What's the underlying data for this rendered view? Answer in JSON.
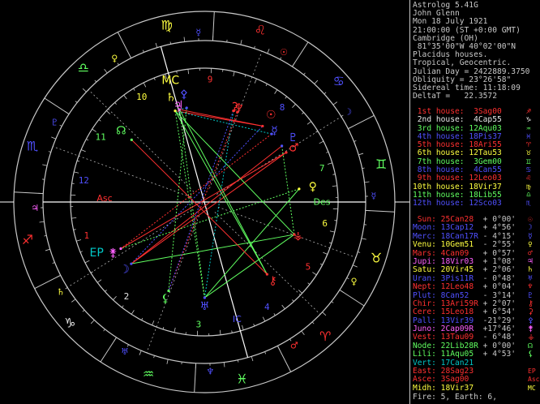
{
  "info_lines": [
    "Astrolog 5.41G",
    "John Glenn",
    "Mon 18 July 1921",
    "21:00:00 (ST +0:00 GMT)",
    "Cambridge (OH)",
    " 81°35'00\"W 40°02'00\"N",
    "Placidus houses.",
    "Tropical, Geocentric.",
    "Julian Day = 2422889.3750",
    "Obliquity = 23°26'58\"",
    "Sidereal time: 11:18:09",
    "DeltaT =   22.3572"
  ],
  "houses": [
    {
      "label": "1st house:",
      "value": "3Sag00",
      "color": "#ff3030",
      "glyph": "♐"
    },
    {
      "label": "2nd house:",
      "value": "4Cap55",
      "color": "#e8e8e8",
      "glyph": "♑"
    },
    {
      "label": "3rd house:",
      "value": "12Aqu03",
      "color": "#60ff60",
      "glyph": "♒"
    },
    {
      "label": "4th house:",
      "value": "18Pis37",
      "color": "#5050ff",
      "glyph": "♓"
    },
    {
      "label": "5th house:",
      "value": "18Ari55",
      "color": "#ff3030",
      "glyph": "♈"
    },
    {
      "label": "6th house:",
      "value": "12Tau53",
      "color": "#ffff40",
      "glyph": "♉"
    },
    {
      "label": "7th house:",
      "value": "3Gem00",
      "color": "#60ff60",
      "glyph": "♊"
    },
    {
      "label": "8th house:",
      "value": "4Can55",
      "color": "#5050ff",
      "glyph": "♋"
    },
    {
      "label": "9th house:",
      "value": "12Leo03",
      "color": "#ff3030",
      "glyph": "♌"
    },
    {
      "label": "10th house:",
      "value": "18Vir37",
      "color": "#ffff40",
      "glyph": "♍"
    },
    {
      "label": "11th house:",
      "value": "18Lib55",
      "color": "#60ff60",
      "glyph": "♎"
    },
    {
      "label": "12th house:",
      "value": "12Sco03",
      "color": "#5050ff",
      "glyph": "♏"
    }
  ],
  "planets": [
    {
      "name": "Sun:",
      "pos": "25Can28",
      "extra": " + 0°00'",
      "color": "#ff3030",
      "glyph": "☉"
    },
    {
      "name": "Moon:",
      "pos": "13Cap12",
      "extra": " + 4°56'",
      "color": "#5050ff",
      "glyph": "☽"
    },
    {
      "name": "Merc:",
      "pos": "18Can17R",
      "extra": " - 4°15'",
      "color": "#5050ff",
      "glyph": "☿"
    },
    {
      "name": "Venu:",
      "pos": "10Gem51",
      "extra": " - 2°55'",
      "color": "#ffff40",
      "glyph": "♀"
    },
    {
      "name": "Mars:",
      "pos": "4Can09",
      "extra": " + 0°57'",
      "color": "#ff3030",
      "glyph": "♂"
    },
    {
      "name": "Jupi:",
      "pos": "18Vir03",
      "extra": " + 1°08'",
      "color": "#ff60ff",
      "glyph": "♃"
    },
    {
      "name": "Satu:",
      "pos": "20Vir45",
      "extra": " + 2°06'",
      "color": "#ffff40",
      "glyph": "♄"
    },
    {
      "name": "Uran:",
      "pos": "3Pis11R",
      "extra": " - 0°48'",
      "color": "#5050ff",
      "glyph": "♅"
    },
    {
      "name": "Nept:",
      "pos": "12Leo48",
      "extra": " + 0°04'",
      "color": "#ff3030",
      "glyph": "♆"
    },
    {
      "name": "Plut:",
      "pos": "8Can52",
      "extra": " - 3°14'",
      "color": "#5050ff",
      "glyph": "♇"
    },
    {
      "name": "Chir:",
      "pos": "13Ari59R",
      "extra": " + 2°07'",
      "color": "#ff3030",
      "glyph": "⚷"
    },
    {
      "name": "Cere:",
      "pos": "15Leo18",
      "extra": " + 6°54'",
      "color": "#ff3030",
      "glyph": "⚳"
    },
    {
      "name": "Pall:",
      "pos": "13Vir39",
      "extra": " -21°29'",
      "color": "#5050ff",
      "glyph": "⚴"
    },
    {
      "name": "Juno:",
      "pos": "2Cap09R",
      "extra": " +17°46'",
      "color": "#ff60ff",
      "glyph": "⚵"
    },
    {
      "name": "Vest:",
      "pos": "13Tau09",
      "extra": " - 6°48'",
      "color": "#ff3030",
      "glyph": "⚶"
    },
    {
      "name": "Node:",
      "pos": "22Lib28R",
      "extra": " + 0°00'",
      "color": "#60ff60",
      "glyph": "☊"
    },
    {
      "name": "Lili:",
      "pos": "11Aqu05",
      "extra": " + 4°53'",
      "color": "#60ff60",
      "glyph": "⚸"
    },
    {
      "name": "Vert:",
      "pos": "17Can21",
      "extra": "",
      "color": "#00c8c8",
      "glyph": ""
    },
    {
      "name": "East:",
      "pos": "28Sag23",
      "extra": "",
      "color": "#ff3030",
      "glyph": "EP"
    },
    {
      "name": "Asce:",
      "pos": "3Sag00",
      "extra": "",
      "color": "#ff3030",
      "glyph": "Asc"
    },
    {
      "name": "Midh:",
      "pos": "18Vir37",
      "extra": "",
      "color": "#ffff40",
      "glyph": "MC"
    }
  ],
  "footer": "Fire: 5, Earth: 6,",
  "wheel": {
    "signs": [
      {
        "glyph": "♐",
        "color": "#ff3030"
      },
      {
        "glyph": "♑",
        "color": "#e8e8e8"
      },
      {
        "glyph": "♒",
        "color": "#60ff60"
      },
      {
        "glyph": "♓",
        "color": "#60ff60"
      },
      {
        "glyph": "♈",
        "color": "#ff3030"
      },
      {
        "glyph": "♉",
        "color": "#ffff40"
      },
      {
        "glyph": "♊",
        "color": "#60ff60"
      },
      {
        "glyph": "♋",
        "color": "#5050ff"
      },
      {
        "glyph": "♌",
        "color": "#ff3030"
      },
      {
        "glyph": "♍",
        "color": "#ffff40"
      },
      {
        "glyph": "♎",
        "color": "#60ff60"
      },
      {
        "glyph": "♏",
        "color": "#5050ff"
      }
    ],
    "rulers": [
      {
        "glyph": "♃",
        "color": "#ff60ff"
      },
      {
        "glyph": "♄",
        "color": "#ffff40"
      },
      {
        "glyph": "♅",
        "color": "#5050ff"
      },
      {
        "glyph": "♆",
        "color": "#5050ff"
      },
      {
        "glyph": "♂",
        "color": "#ff3030"
      },
      {
        "glyph": "♀",
        "color": "#ffff40"
      },
      {
        "glyph": "☿",
        "color": "#5050ff"
      },
      {
        "glyph": "☽",
        "color": "#5050ff"
      },
      {
        "glyph": "☉",
        "color": "#ff3030"
      },
      {
        "glyph": "☿",
        "color": "#5050ff"
      },
      {
        "glyph": "♀",
        "color": "#ffff40"
      },
      {
        "glyph": "♇",
        "color": "#5050ff"
      }
    ],
    "house_numbers": [
      "1",
      "2",
      "3",
      "4",
      "5",
      "6",
      "7",
      "8",
      "9",
      "10",
      "11",
      "12"
    ],
    "labels": {
      "asc": "Asc",
      "des": "Des",
      "mc": "MC",
      "ic": "IC",
      "ep": "EP"
    }
  }
}
